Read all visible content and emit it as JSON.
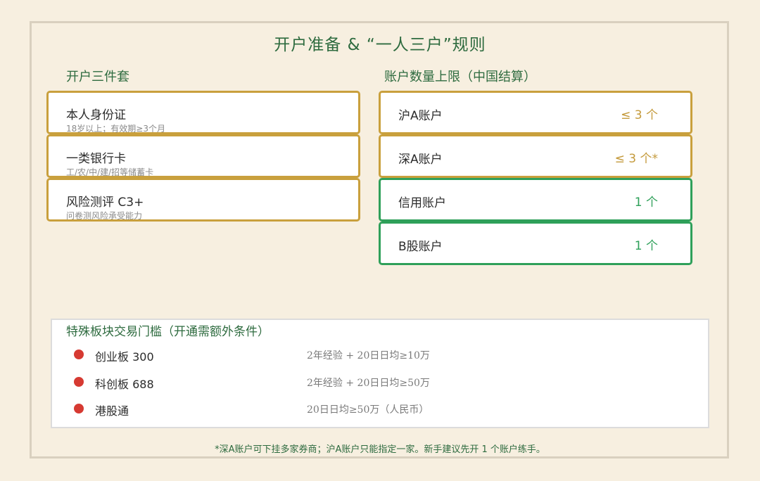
{
  "title": "开户准备 & “一人三户”规则",
  "kit": {
    "heading": "开户三件套",
    "items": [
      {
        "label": "本人身份证",
        "sub": "18岁以上；有效期≥3个月"
      },
      {
        "label": "一类银行卡",
        "sub": "工/农/中/建/招等储蓄卡"
      },
      {
        "label": "风险测评 C3+",
        "sub": "问卷测风险承受能力"
      }
    ]
  },
  "limits": {
    "heading": "账户数量上限（中国结算）",
    "items": [
      {
        "label": "沪A账户",
        "value": "≤ 3 个"
      },
      {
        "label": "深A账户",
        "value": "≤ 3 个*"
      },
      {
        "label": "信用账户",
        "value": "1 个"
      },
      {
        "label": "B股账户",
        "value": "1 个"
      }
    ]
  },
  "boards": {
    "heading": "特殊板块交易门槛（开通需额外条件）",
    "items": [
      {
        "name": "创业板 300",
        "requirement": "2年经验 + 20日日均≥10万"
      },
      {
        "name": "科创板 688",
        "requirement": "2年经验 + 20日日均≥50万"
      },
      {
        "name": "港股通",
        "requirement": "20日日均≥50万（人民币）"
      }
    ]
  },
  "footnote": "*深A账户可下挂多家券商；沪A账户只能指定一家。新手建议先开 1 个账户练手。",
  "colors": {
    "background": "#f7efe0",
    "heading_green": "#2e6b3f",
    "gold_border": "#c9a03d",
    "green_border": "#2fa05a",
    "bullet_red": "#d63a32"
  }
}
